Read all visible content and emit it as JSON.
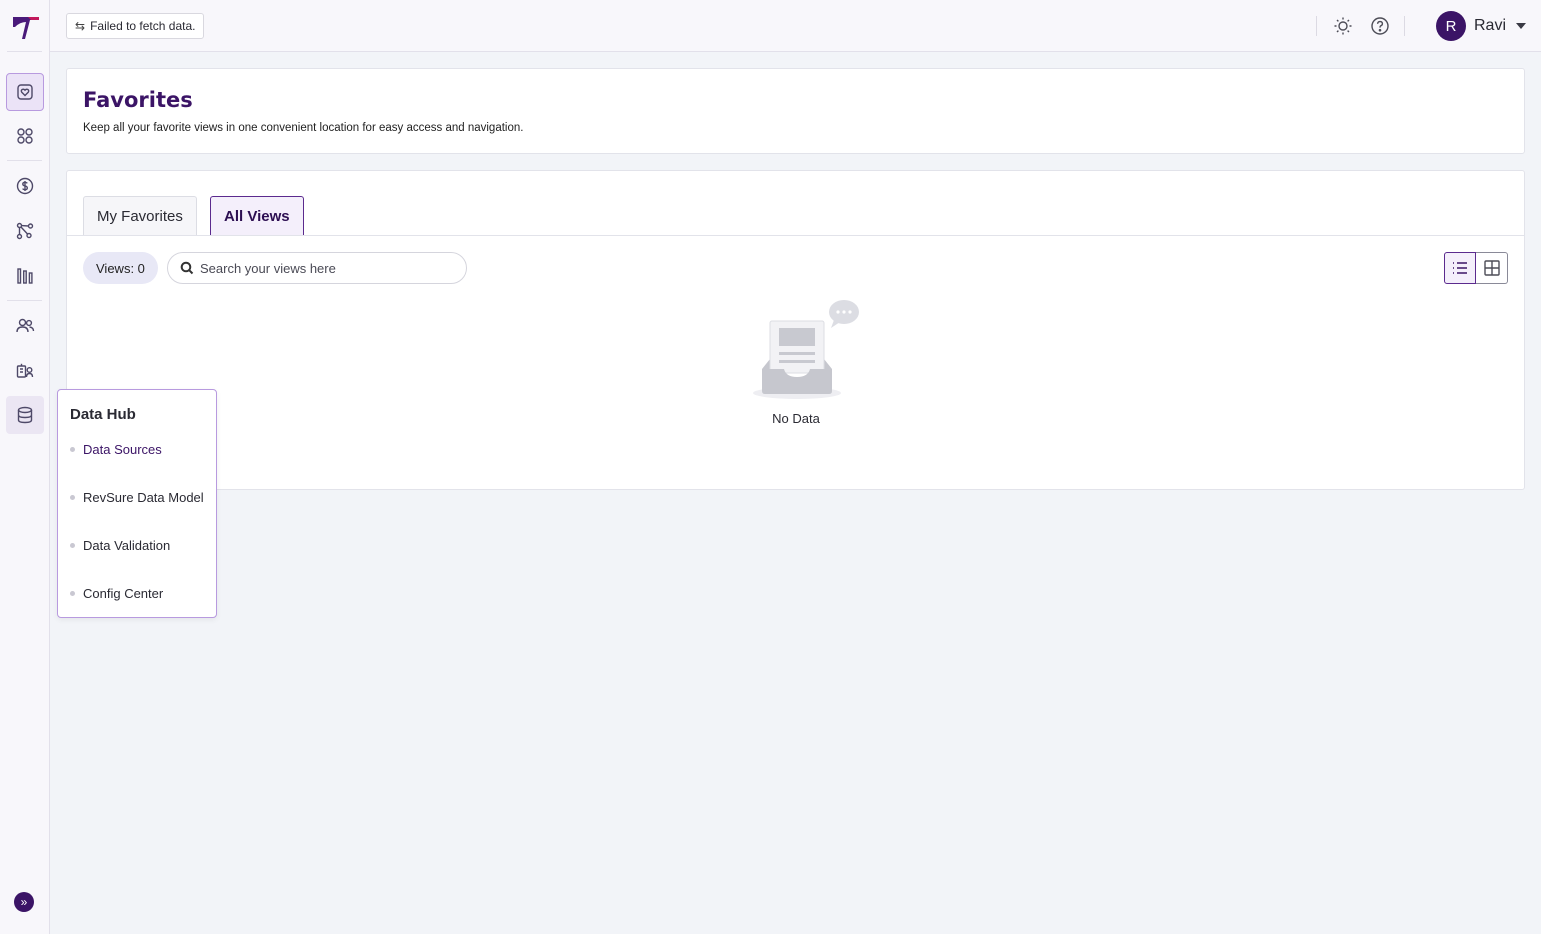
{
  "topbar": {
    "status_text": "Failed to fetch data.",
    "user_initial": "R",
    "user_name": "Ravi"
  },
  "header": {
    "title": "Favorites",
    "subtitle": "Keep all your favorite views in one convenient location for easy access and navigation."
  },
  "tabs": [
    {
      "label": "My Favorites",
      "active": false
    },
    {
      "label": "All Views",
      "active": true
    }
  ],
  "toolbar": {
    "views_count_label": "Views: 0",
    "search_placeholder": "Search your views here",
    "view_mode": "list"
  },
  "empty_state": {
    "label": "No Data"
  },
  "sidebar": {
    "items": [
      "favorites-icon",
      "dashboard-grid-icon",
      "revenue-icon",
      "flow-icon",
      "pipeline-bars-icon",
      "users-icon",
      "accounts-icon",
      "database-icon"
    ],
    "active_item": "favorites-icon",
    "expanded_menu": "database-icon"
  },
  "data_hub_menu": {
    "title": "Data Hub",
    "items": [
      {
        "label": "Data Sources",
        "active": true
      },
      {
        "label": "RevSure Data Model",
        "active": false
      },
      {
        "label": "Data Validation",
        "active": false
      },
      {
        "label": "Config Center",
        "active": false
      }
    ]
  },
  "colors": {
    "brand": "#3b1466",
    "accent_border": "#b89adf",
    "active_bg": "#ebe3f7",
    "page_bg": "#f2f4f8"
  }
}
